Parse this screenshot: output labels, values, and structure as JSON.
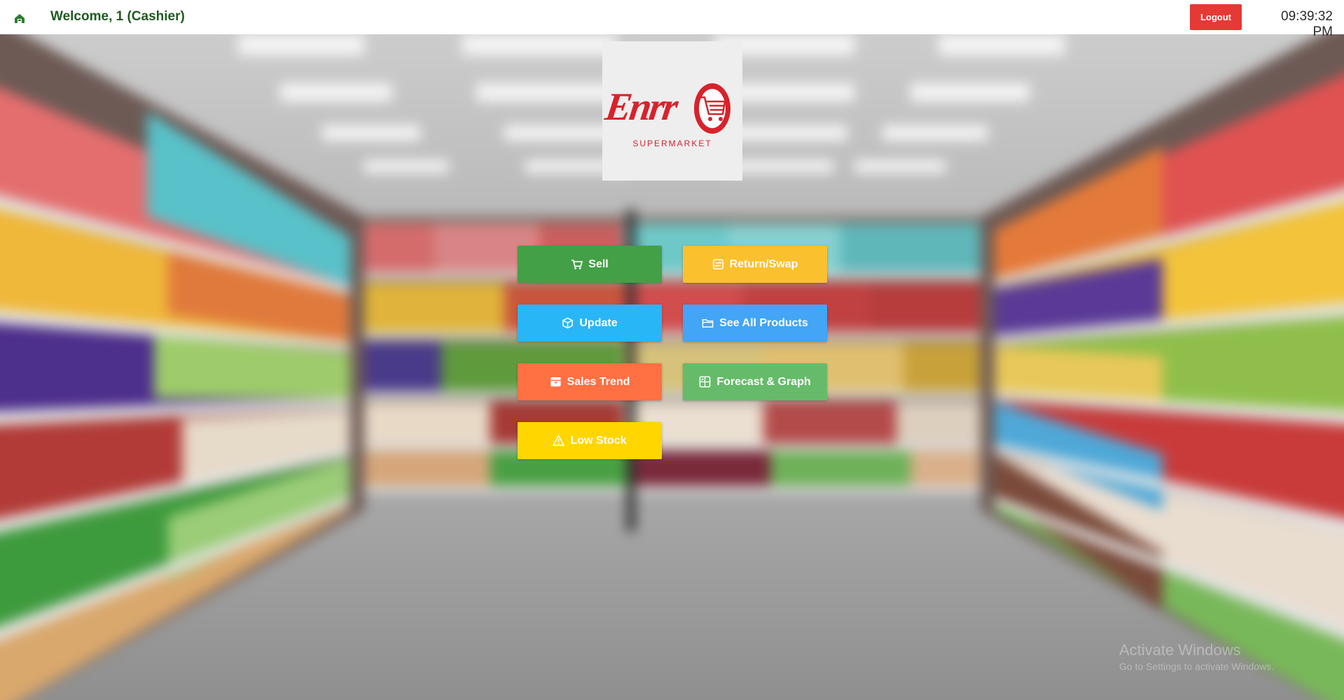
{
  "header": {
    "welcome": "Welcome, 1 (Cashier)",
    "logout_label": "Logout",
    "time": "09:39:32 PM",
    "home_icon": "home-icon"
  },
  "logo": {
    "brand": "Enrr",
    "subtitle": "SUPERMARKET"
  },
  "menu": {
    "sell": {
      "label": "Sell",
      "icon": "cart-icon",
      "color": "#43a047"
    },
    "return_swap": {
      "label": "Return/Swap",
      "icon": "swap-icon",
      "color": "#fbc02d"
    },
    "update": {
      "label": "Update",
      "icon": "box-icon",
      "color": "#29b6f6"
    },
    "see_all_products": {
      "label": "See All Products",
      "icon": "folder-icon",
      "color": "#42a5f5"
    },
    "sales_trend": {
      "label": "Sales Trend",
      "icon": "archive-icon",
      "color": "#ff7043"
    },
    "forecast_graph": {
      "label": "Forecast & Graph",
      "icon": "chart-grid-icon",
      "color": "#66bb6a"
    },
    "low_stock": {
      "label": "Low Stock",
      "icon": "warning-icon",
      "color": "#ffd600"
    }
  },
  "watermark": {
    "title": "Activate Windows",
    "subtitle": "Go to Settings to activate Windows."
  }
}
